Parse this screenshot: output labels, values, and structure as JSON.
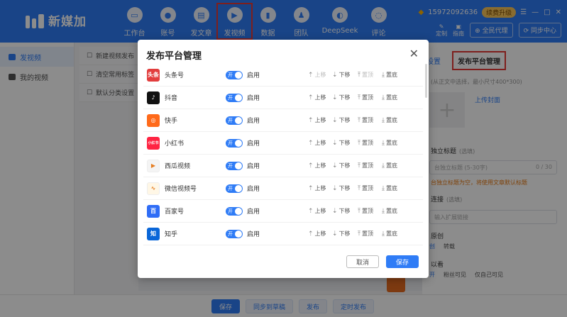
{
  "app": {
    "name": "新媒加",
    "phone": "15972092636",
    "vip": "续费升级",
    "window_controls": [
      "☰",
      "—",
      "□",
      "✕"
    ]
  },
  "nav": [
    {
      "label": "工作台",
      "icon": "workbench-icon",
      "glyph": "▭"
    },
    {
      "label": "账号",
      "icon": "user-icon",
      "glyph": "●"
    },
    {
      "label": "发文章",
      "icon": "article-icon",
      "glyph": "▤"
    },
    {
      "label": "发视频",
      "icon": "video-icon",
      "glyph": "▶"
    },
    {
      "label": "数据",
      "icon": "chart-icon",
      "glyph": "▮"
    },
    {
      "label": "团队",
      "icon": "team-icon",
      "glyph": "♟"
    },
    {
      "label": "DeepSeek",
      "icon": "deepseek-icon",
      "glyph": "◐"
    },
    {
      "label": "评论",
      "icon": "comment-icon",
      "glyph": "◌"
    }
  ],
  "tools": {
    "custom": "定制",
    "guide": "指南",
    "proxy": "全民代理",
    "sync": "同步中心"
  },
  "sidebar": [
    {
      "label": "发视频",
      "active": true
    },
    {
      "label": "我的视频",
      "active": false
    }
  ],
  "subpanel": [
    "新建视频发布",
    "清空常用标签",
    "默认分类设置"
  ],
  "right_panel": {
    "tab_settings": "设置",
    "tab_platform": "发布平台管理",
    "cover_hint": "(从正文中选择，最小尺寸400*300)",
    "upload_cover": "上传封面",
    "title_label": "独立标题",
    "optional": "(选填)",
    "title_placeholder": "台独立标题 (5-30字)",
    "title_count": "0 / 30",
    "title_warn": "台独立标题为空，将使用文章默认标题",
    "link_label": "连接",
    "link_optional": "(选填)",
    "link_placeholder": "输入扩展链接",
    "original_label": "原创",
    "original_opts": [
      "创",
      "转载"
    ],
    "visible_label": "以看",
    "visible_opts": [
      "开",
      "粉丝可见",
      "仅自己可见"
    ]
  },
  "bottom_bar": {
    "save": "保存",
    "sync_draft": "同步到草稿",
    "publish": "发布",
    "schedule": "定时发布"
  },
  "modal": {
    "title": "发布平台管理",
    "cancel": "取消",
    "save": "保存",
    "toggle_on": "开",
    "status": "启用",
    "actions": {
      "up": "上移",
      "down": "下移",
      "top": "置顶",
      "bottom": "置底"
    },
    "platforms": [
      {
        "name": "头条号",
        "logo_text": "头条",
        "color": "#e23d3d",
        "first": true,
        "last": false
      },
      {
        "name": "抖音",
        "logo_text": "♪",
        "color": "#111111",
        "first": false,
        "last": false
      },
      {
        "name": "快手",
        "logo_text": "◎",
        "color": "#ff6a1a",
        "first": false,
        "last": false
      },
      {
        "name": "小红书",
        "logo_text": "小红书",
        "color": "#ff2442",
        "first": false,
        "last": false
      },
      {
        "name": "西瓜视频",
        "logo_text": "▶",
        "color": "#f4f4f4",
        "first": false,
        "last": false
      },
      {
        "name": "微信视频号",
        "logo_text": "∿",
        "color": "#fff7e6",
        "first": false,
        "last": false
      },
      {
        "name": "百家号",
        "logo_text": "百",
        "color": "#2f6df6",
        "first": false,
        "last": false
      },
      {
        "name": "知乎",
        "logo_text": "知",
        "color": "#0a66d8",
        "first": false,
        "last": false
      }
    ]
  }
}
